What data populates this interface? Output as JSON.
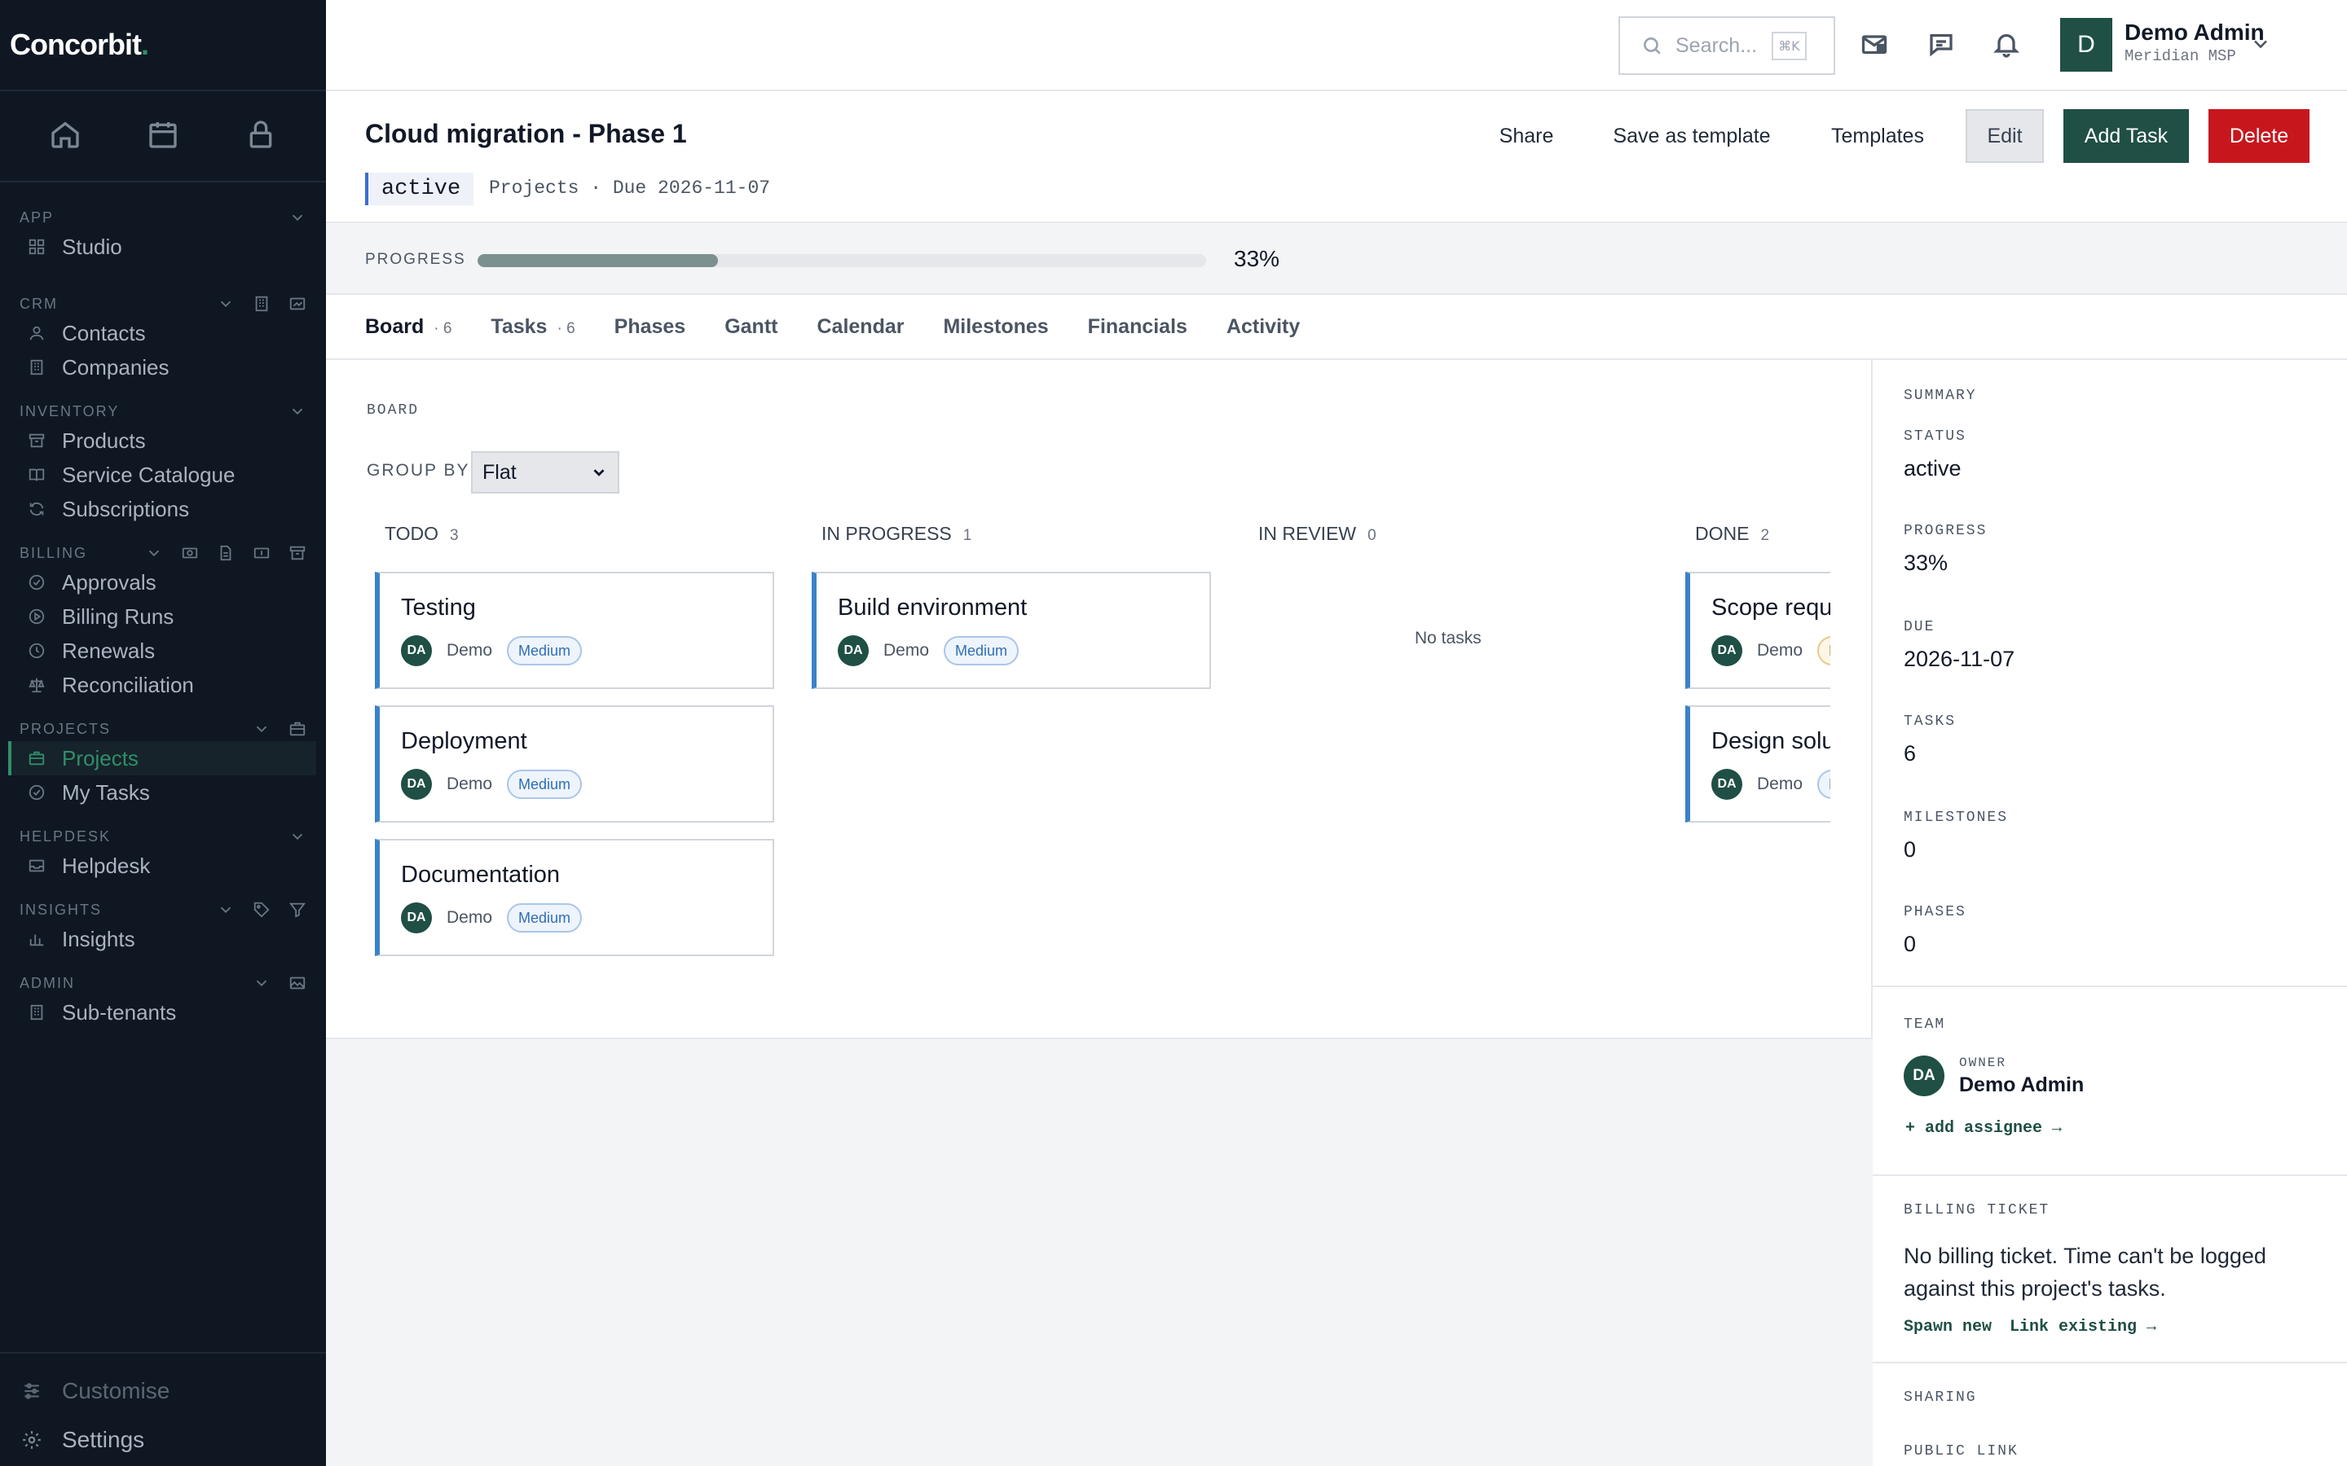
{
  "brand": {
    "name": "Concorbit",
    "dot": "."
  },
  "sidebar": {
    "quick_icons": [
      "home-icon",
      "calendar-icon",
      "lock-icon"
    ],
    "sections": {
      "app": {
        "label": "APP",
        "items": [
          {
            "label": "Studio",
            "icon": "grid-icon"
          }
        ]
      },
      "crm": {
        "label": "CRM",
        "items": [
          {
            "label": "Contacts",
            "icon": "person-icon"
          },
          {
            "label": "Companies",
            "icon": "building-icon"
          }
        ]
      },
      "inventory": {
        "label": "INVENTORY",
        "items": [
          {
            "label": "Products",
            "icon": "box-icon"
          },
          {
            "label": "Service Catalogue",
            "icon": "book-icon"
          },
          {
            "label": "Subscriptions",
            "icon": "refresh-icon"
          }
        ]
      },
      "billing": {
        "label": "BILLING",
        "items": [
          {
            "label": "Approvals",
            "icon": "check-circle-icon"
          },
          {
            "label": "Billing Runs",
            "icon": "play-circle-icon"
          },
          {
            "label": "Renewals",
            "icon": "clock-icon"
          },
          {
            "label": "Reconciliation",
            "icon": "scale-icon"
          }
        ]
      },
      "projects": {
        "label": "PROJECTS",
        "items": [
          {
            "label": "Projects",
            "icon": "briefcase-icon",
            "active": true
          },
          {
            "label": "My Tasks",
            "icon": "check-circle-icon"
          }
        ]
      },
      "helpdesk": {
        "label": "HELPDESK",
        "items": [
          {
            "label": "Helpdesk",
            "icon": "inbox-icon"
          }
        ]
      },
      "insights": {
        "label": "INSIGHTS",
        "items": [
          {
            "label": "Insights",
            "icon": "bar-chart-icon"
          }
        ]
      },
      "admin": {
        "label": "ADMIN",
        "items": [
          {
            "label": "Sub-tenants",
            "icon": "building-icon"
          }
        ]
      }
    },
    "footer": {
      "customise": "Customise",
      "settings": "Settings"
    }
  },
  "topbar": {
    "search_placeholder": "Search...",
    "search_shortcut": "⌘K",
    "user": {
      "initial": "D",
      "name": "Demo Admin",
      "org": "Meridian MSP"
    }
  },
  "project": {
    "title": "Cloud migration - Phase 1",
    "status": "active",
    "meta": "Projects · Due 2026-11-07",
    "actions": {
      "share": "Share",
      "save_template": "Save as template",
      "templates": "Templates",
      "edit": "Edit",
      "add_task": "Add Task",
      "delete": "Delete"
    },
    "progress_label": "PROGRESS",
    "progress_value": 0.33,
    "progress_text": "33%"
  },
  "tabs": [
    {
      "label": "Board",
      "count": "6",
      "active": true
    },
    {
      "label": "Tasks",
      "count": "6"
    },
    {
      "label": "Phases"
    },
    {
      "label": "Gantt"
    },
    {
      "label": "Calendar"
    },
    {
      "label": "Milestones"
    },
    {
      "label": "Financials"
    },
    {
      "label": "Activity"
    }
  ],
  "board": {
    "label": "BOARD",
    "group_by_label": "GROUP BY",
    "group_by_value": "Flat",
    "empty_text": "No tasks",
    "columns": [
      {
        "name": "TODO",
        "count": "3",
        "cards": [
          {
            "title": "Testing",
            "initials": "DA",
            "owner": "Demo",
            "priority": "Medium"
          },
          {
            "title": "Deployment",
            "initials": "DA",
            "owner": "Demo",
            "priority": "Medium"
          },
          {
            "title": "Documentation",
            "initials": "DA",
            "owner": "Demo",
            "priority": "Medium"
          }
        ]
      },
      {
        "name": "IN PROGRESS",
        "count": "1",
        "cards": [
          {
            "title": "Build environment",
            "initials": "DA",
            "owner": "Demo",
            "priority": "Medium"
          }
        ]
      },
      {
        "name": "IN REVIEW",
        "count": "0",
        "cards": []
      },
      {
        "name": "DONE",
        "count": "2",
        "cards": [
          {
            "title": "Scope requ",
            "initials": "DA",
            "owner": "Demo",
            "priority": "H"
          },
          {
            "title": "Design solu",
            "initials": "DA",
            "owner": "Demo",
            "priority": "M"
          }
        ]
      }
    ]
  },
  "summary": {
    "title": "SUMMARY",
    "status_label": "STATUS",
    "status": "active",
    "progress_label": "PROGRESS",
    "progress": "33%",
    "due_label": "DUE",
    "due": "2026-11-07",
    "tasks_label": "TASKS",
    "tasks": "6",
    "milestones_label": "MILESTONES",
    "milestones": "0",
    "phases_label": "PHASES",
    "phases": "0"
  },
  "team": {
    "title": "TEAM",
    "initials": "DA",
    "role": "OWNER",
    "name": "Demo Admin",
    "add_link": "+ add assignee →"
  },
  "billing_ticket": {
    "title": "BILLING TICKET",
    "text": "No billing ticket. Time can't be logged against this project's tasks.",
    "spawn": "Spawn new",
    "link": "Link existing →"
  },
  "sharing": {
    "title": "SHARING",
    "public_link": "PUBLIC LINK"
  }
}
